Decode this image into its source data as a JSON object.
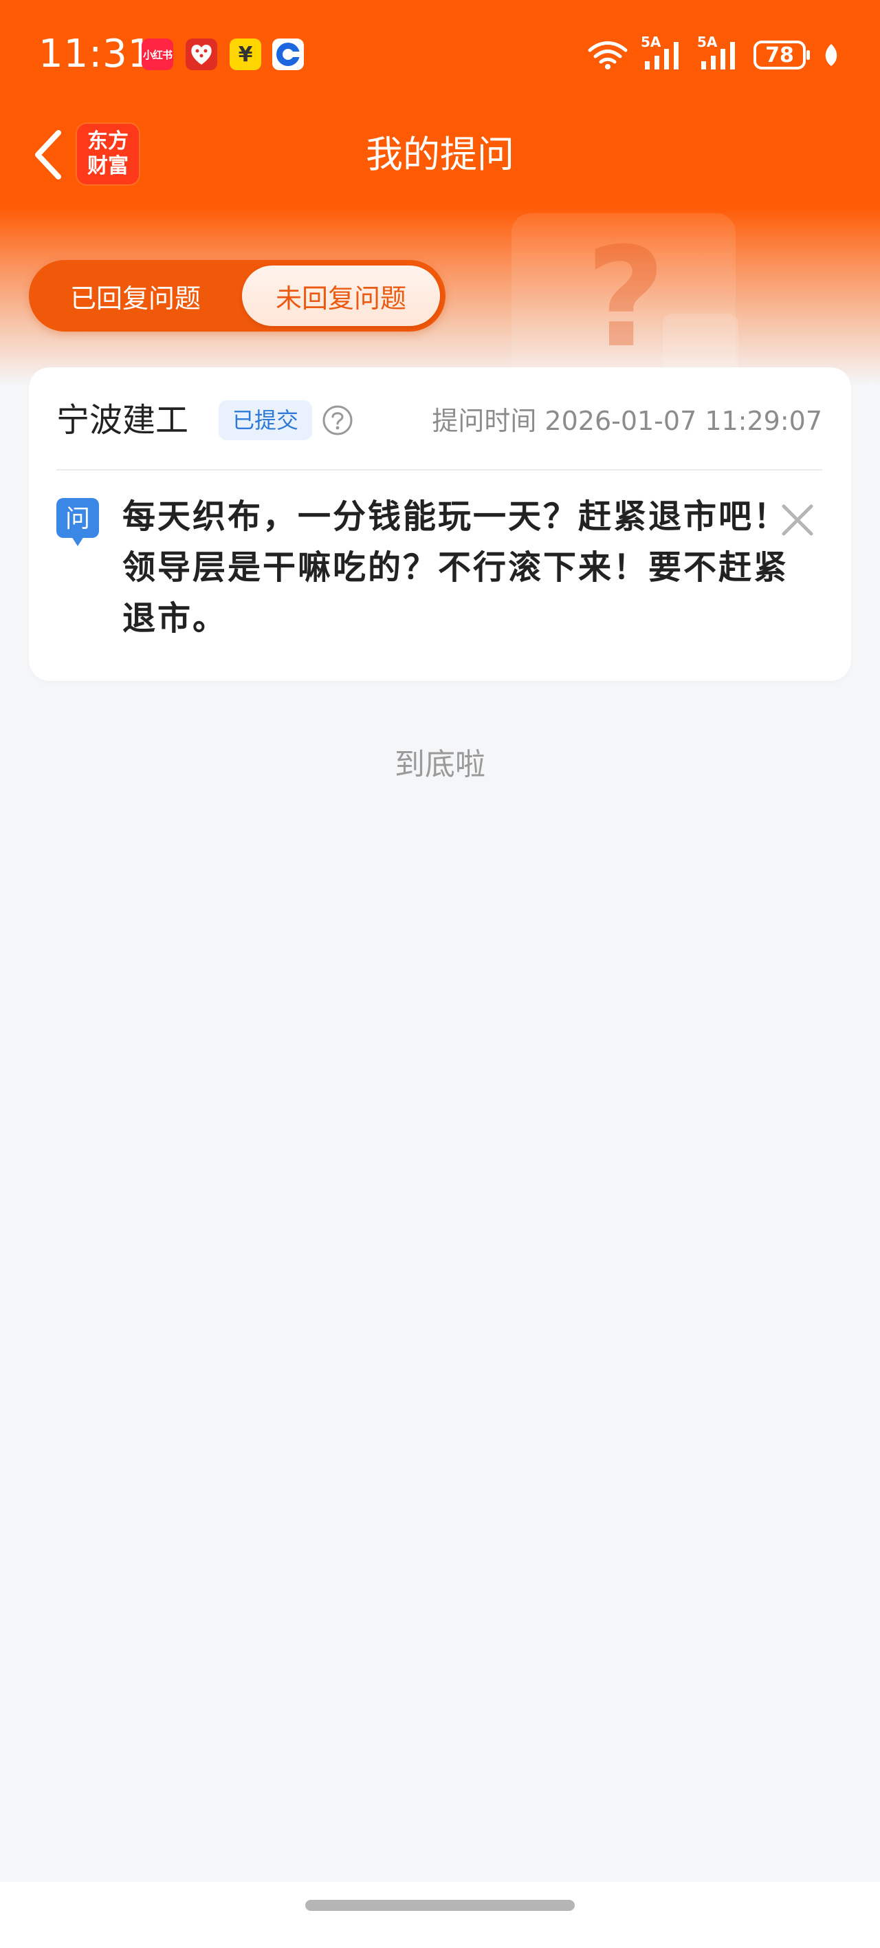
{
  "status_bar": {
    "time": "11:31",
    "notification_icons": [
      {
        "name": "xiaohongshu-app-icon",
        "label": "小红书",
        "color": "#ff2442"
      },
      {
        "name": "pinduoduo-app-icon",
        "label": "",
        "color": "#e02e24"
      },
      {
        "name": "xianyu-app-icon",
        "label": "¥",
        "color": "#ffd600"
      },
      {
        "name": "ccb-bank-app-icon",
        "label": "",
        "color": "#1c66e0"
      }
    ],
    "signal_1_label": "5A",
    "signal_2_label": "5A",
    "battery": "78"
  },
  "nav": {
    "logo_line1": "东方",
    "logo_line2": "财富",
    "title": "我的提问"
  },
  "tabs": [
    {
      "label": "已回复问题",
      "active": false
    },
    {
      "label": "未回复问题",
      "active": true
    }
  ],
  "questions": [
    {
      "company": "宁波建工",
      "status": "已提交",
      "time_label": "提问时间 2026-01-07 11:29:07",
      "ask_icon_label": "问",
      "text": "每天织布，一分钱能玩一天？赶紧退市吧！领导层是干嘛吃的？不行滚下来！要不赶紧退市。"
    }
  ],
  "footer": {
    "end_text": "到底啦"
  },
  "colors": {
    "brand_orange": "#ff5a04",
    "tab_active_text": "#ea5a10",
    "badge_blue": "#2f7ad8",
    "ask_icon_blue": "#3b87e6"
  }
}
